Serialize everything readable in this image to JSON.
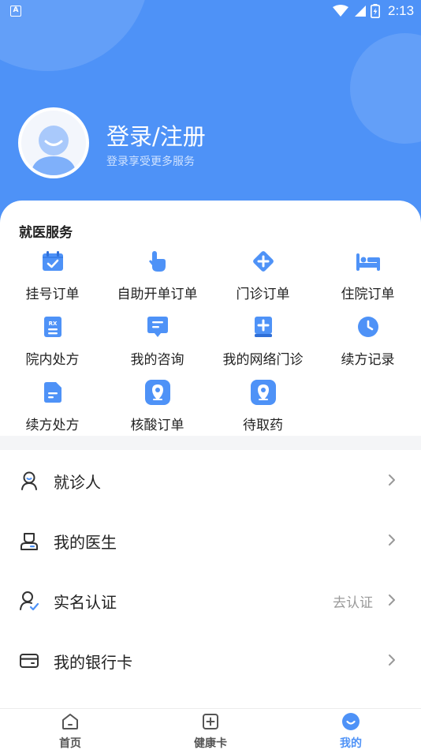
{
  "status_bar": {
    "time": "2:13",
    "app_badge": "A"
  },
  "profile": {
    "title": "登录/注册",
    "subtitle": "登录享受更多服务"
  },
  "services": {
    "title": "就医服务",
    "items": [
      {
        "label": "挂号订单",
        "icon": "calendar-check-icon"
      },
      {
        "label": "自助开单订单",
        "icon": "hand-pointer-icon"
      },
      {
        "label": "门诊订单",
        "icon": "diamond-plus-icon"
      },
      {
        "label": "住院订单",
        "icon": "hospital-bed-icon"
      },
      {
        "label": "院内处方",
        "icon": "prescription-rx-icon"
      },
      {
        "label": "我的咨询",
        "icon": "chat-bubble-icon"
      },
      {
        "label": "我的网络门诊",
        "icon": "medical-book-icon"
      },
      {
        "label": "续方记录",
        "icon": "clock-icon"
      },
      {
        "label": "续方处方",
        "icon": "document-icon"
      },
      {
        "label": "核酸订单",
        "icon": "location-pin-icon"
      },
      {
        "label": "待取药",
        "icon": "location-pin-icon"
      }
    ]
  },
  "menu": [
    {
      "label": "就诊人",
      "extra": "",
      "icon": "patient-icon"
    },
    {
      "label": "我的医生",
      "extra": "",
      "icon": "doctor-icon"
    },
    {
      "label": "实名认证",
      "extra": "去认证",
      "icon": "verified-user-icon"
    },
    {
      "label": "我的银行卡",
      "extra": "",
      "icon": "bank-card-icon"
    }
  ],
  "tabs": [
    {
      "label": "首页",
      "icon": "home-icon",
      "active": false
    },
    {
      "label": "健康卡",
      "icon": "health-card-icon",
      "active": false
    },
    {
      "label": "我的",
      "icon": "smile-profile-icon",
      "active": true
    }
  ],
  "colors": {
    "primary": "#4e92f7",
    "background": "#f4f5f7",
    "text": "#222222",
    "muted": "#9a9a9a"
  }
}
